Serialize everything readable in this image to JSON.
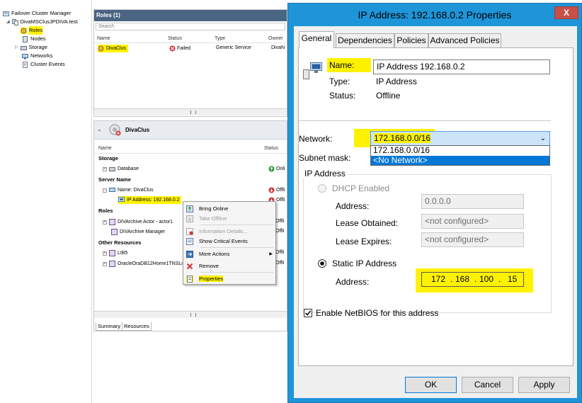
{
  "tree": {
    "title": "Failover Cluster Manager",
    "cluster": "DivaMSClusJPDIVA.test",
    "items": [
      {
        "label": "Roles",
        "icon": "roles-icon",
        "highlighted": true
      },
      {
        "label": "Nodes",
        "icon": "nodes-icon"
      },
      {
        "label": "Storage",
        "icon": "storage-icon"
      },
      {
        "label": "Networks",
        "icon": "networks-icon"
      },
      {
        "label": "Cluster Events",
        "icon": "cluster-events-icon"
      }
    ]
  },
  "roles_pane": {
    "title": "Roles (1)",
    "search_placeholder": "Search",
    "columns": [
      "Name",
      "Status",
      "Type",
      "Owner"
    ],
    "rows": [
      {
        "name": "DivaClus",
        "status": "Failed",
        "type": "Generic Service",
        "owner": "DivaN"
      }
    ]
  },
  "resources_pane": {
    "title": "DivaClus",
    "columns": [
      "Name",
      "Status"
    ],
    "groups": {
      "storage": "Storage",
      "server_name": "Server Name",
      "roles": "Roles",
      "other": "Other Resources"
    },
    "rows": {
      "database": "Database",
      "name_divaclus": "Name: DivaClus",
      "ip_address": "IP Address: 192.168.0.2",
      "actor": "DIVArchive Actor - actor1",
      "manager": "DIVArchive Manager",
      "lib5": "LIB5",
      "oracle": "OracleOraDB12Home1TNSLi"
    },
    "statuses": {
      "database": "Onli",
      "name_divaclus": "Offli",
      "ip_address": "Offli",
      "actor": "Offli",
      "manager": "Offli",
      "lib5": "Offli",
      "oracle": "Offli"
    },
    "tabs": [
      "Summary",
      "Resources"
    ]
  },
  "context_menu": {
    "items": [
      {
        "label": "Bring Online",
        "icon": "bring-online-icon",
        "disabled": false
      },
      {
        "label": "Take Offline",
        "icon": "take-offline-icon",
        "disabled": true
      },
      {
        "label": "Information Details...",
        "icon": "information-icon",
        "disabled": true
      },
      {
        "label": "Show Critical Events",
        "icon": "critical-events-icon",
        "disabled": false
      },
      {
        "label": "More Actions",
        "icon": "more-actions-icon",
        "disabled": false
      },
      {
        "label": "Remove",
        "icon": "remove-icon",
        "disabled": false
      },
      {
        "label": "Properties",
        "icon": "properties-icon",
        "disabled": false
      }
    ]
  },
  "dialog": {
    "title": "IP Address: 192.168.0.2 Properties",
    "close_label": "X",
    "tabs": [
      "General",
      "Dependencies",
      "Policies",
      "Advanced Policies"
    ],
    "name_label": "Name:",
    "name_value": "IP Address 192.168.0.2",
    "type_label": "Type:",
    "type_value": "IP Address",
    "status_label": "Status:",
    "status_value": "Offline",
    "network_label": "Network:",
    "network_value": "172.168.0.0/16",
    "network_options": [
      "172.168.0.0/16",
      "<No Network>"
    ],
    "subnet_label": "Subnet mask:",
    "ip_group_label": "IP Address",
    "dhcp_label": "DHCP Enabled",
    "dhcp_address_label": "Address:",
    "dhcp_address_value": "0.0.0.0",
    "lease_obtained_label": "Lease Obtained:",
    "lease_obtained_value": "<not configured>",
    "lease_expires_label": "Lease Expires:",
    "lease_expires_value": "<not configured>",
    "static_label": "Static IP Address",
    "static_address_label": "Address:",
    "static_octets": [
      "172",
      "168",
      "100",
      "15"
    ],
    "netbios_label": "Enable NetBIOS for this address",
    "buttons": {
      "ok": "OK",
      "cancel": "Cancel",
      "apply": "Apply"
    }
  },
  "colors": {
    "highlight": "#fff200",
    "dialog_frame": "#1f95d9",
    "close_button": "#c7504a",
    "dropdown_selected": "#0078d7",
    "pane_header": "#4a6584"
  }
}
